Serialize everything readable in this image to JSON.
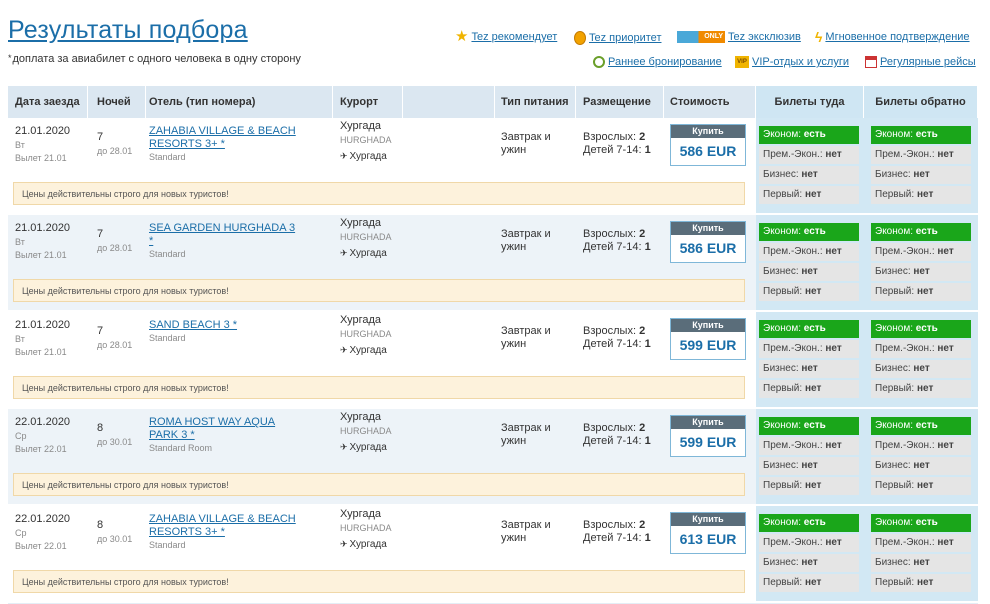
{
  "page_title": "Результаты подбора",
  "note": "доплата за авиабилет с одного человека в одну сторону",
  "legend": [
    {
      "label": "Tez рекомендует",
      "icon": "star-icon"
    },
    {
      "label": "Tez приоритет",
      "icon": "medal-icon"
    },
    {
      "label": "Tez эксклюзив",
      "icon": "only-icon",
      "badge": "ONLY"
    },
    {
      "label": "Мгновенное подтверждение",
      "icon": "lightning-icon"
    },
    {
      "label": "Раннее бронирование",
      "icon": "clock-icon"
    },
    {
      "label": "VIP-отдых и услуги",
      "icon": "vip-icon",
      "badge": "VIP"
    },
    {
      "label": "Регулярные рейсы",
      "icon": "calendar-icon"
    }
  ],
  "columns": {
    "date": "Дата заезда",
    "nights": "Ночей",
    "hotel": "Отель (тип номера)",
    "resort": "Курорт",
    "food": "Тип питания",
    "accom": "Размещение",
    "price": "Стоимость",
    "there": "Билеты туда",
    "back": "Билеты обратно"
  },
  "common": {
    "buy": "Купить",
    "notice": "Цены действительны строго для новых туристов!",
    "adults_label": "Взрослых:",
    "kids_label": "Детей 7-14:",
    "t1": "Эконом:",
    "t2": "Прем.-Экон.:",
    "t3": "Бизнес:",
    "t4": "Первый:",
    "yes": "есть",
    "no": "нет"
  },
  "rows": [
    {
      "date": "21.01.2020",
      "dow": "Вт",
      "flight": "Вылет 21.01",
      "nights": "7",
      "until": "до 28.01",
      "hotel": "ZAHABIA VILLAGE & BEACH RESORTS 3+ *",
      "room": "Standard",
      "resort": "Хургада",
      "resort_en": "HURGHADA",
      "airport": "Хургада",
      "food": "Завтрак и ужин",
      "adults": "2",
      "kids": "1",
      "price": "586 EUR"
    },
    {
      "date": "21.01.2020",
      "dow": "Вт",
      "flight": "Вылет 21.01",
      "nights": "7",
      "until": "до 28.01",
      "hotel": "SEA GARDEN HURGHADA 3 *",
      "room": "Standard",
      "resort": "Хургада",
      "resort_en": "HURGHADA",
      "airport": "Хургада",
      "food": "Завтрак и ужин",
      "adults": "2",
      "kids": "1",
      "price": "586 EUR"
    },
    {
      "date": "21.01.2020",
      "dow": "Вт",
      "flight": "Вылет 21.01",
      "nights": "7",
      "until": "до 28.01",
      "hotel": "SAND BEACH 3 *",
      "room": "Standard",
      "resort": "Хургада",
      "resort_en": "HURGHADA",
      "airport": "Хургада",
      "food": "Завтрак и ужин",
      "adults": "2",
      "kids": "1",
      "price": "599 EUR"
    },
    {
      "date": "22.01.2020",
      "dow": "Ср",
      "flight": "Вылет 22.01",
      "nights": "8",
      "until": "до 30.01",
      "hotel": "ROMA HOST WAY AQUA PARK 3 *",
      "room": "Standard Room",
      "resort": "Хургада",
      "resort_en": "HURGHADA",
      "airport": "Хургада",
      "food": "Завтрак и ужин",
      "adults": "2",
      "kids": "1",
      "price": "599 EUR"
    },
    {
      "date": "22.01.2020",
      "dow": "Ср",
      "flight": "Вылет 22.01",
      "nights": "8",
      "until": "до 30.01",
      "hotel": "ZAHABIA VILLAGE & BEACH RESORTS 3+ *",
      "room": "Standard",
      "resort": "Хургада",
      "resort_en": "HURGHADA",
      "airport": "Хургада",
      "food": "Завтрак и ужин",
      "adults": "2",
      "kids": "1",
      "price": "613 EUR"
    }
  ]
}
